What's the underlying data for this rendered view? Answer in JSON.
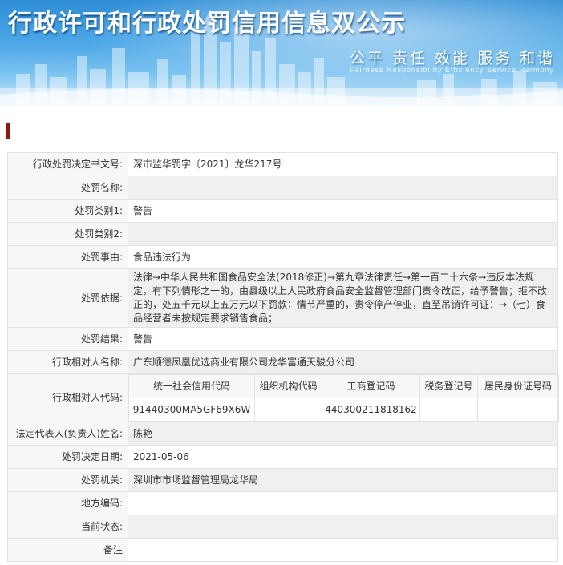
{
  "banner": {
    "title": "行政许可和行政处罚信用信息双公示",
    "slogan": "公平  责任  效能  服务  和谐",
    "slogan_en": "Fairness  Responsibility  Efficiency  Service  Harmony"
  },
  "colors": {
    "banner_top": "#2f8ed6",
    "banner_bottom": "#cfe8f8",
    "section_marker": "#8b1a1a",
    "label_bg": "#f7f7f7",
    "alt_row_bg": "#f0f0f0",
    "border": "#e2e2e2"
  },
  "record": {
    "doc_no": {
      "label": "行政处罚决定书文号:",
      "value": "深市监华罚字〔2021〕龙华217号"
    },
    "penalty_name": {
      "label": "处罚名称:",
      "value": ""
    },
    "category1": {
      "label": "处罚类别1:",
      "value": "警告"
    },
    "category2": {
      "label": "处罚类别2:",
      "value": ""
    },
    "reason": {
      "label": "处罚事由:",
      "value": "食品违法行为"
    },
    "basis": {
      "label": "处罚依据:",
      "value": "法律→中华人民共和国食品安全法(2018修正)→第九章法律责任→第一百二十六条→违反本法规定，有下列情形之一的，由县级以上人民政府食品安全监督管理部门责令改正，给予警告；拒不改正的，处五千元以上五万元以下罚款；情节严重的，责令停产停业，直至吊销许可证：→（七）食品经营者未按规定要求销售食品；"
    },
    "result": {
      "label": "处罚结果:",
      "value": "警告"
    },
    "party_name": {
      "label": "行政相对人名称:",
      "value": "广东顺德凤凰优选商业有限公司龙华富通天骏分公司"
    },
    "party_code": {
      "label": "行政相对人代码:",
      "headers": [
        "统一社会信用代码",
        "组织机构代码",
        "工商登记码",
        "税务登记号",
        "居民身份证号码"
      ],
      "values": [
        "91440300MA5GF69X6W",
        "",
        "440300211818162",
        "",
        ""
      ]
    },
    "legal_rep": {
      "label": "法定代表人(负责人)姓名:",
      "value": "陈艳"
    },
    "decision_date": {
      "label": "处罚决定日期:",
      "value": "2021-05-06"
    },
    "authority": {
      "label": "处罚机关:",
      "value": "深圳市市场监督管理局龙华局"
    },
    "region_code": {
      "label": "地方编码:",
      "value": ""
    },
    "status": {
      "label": "当前状态:",
      "value": ""
    },
    "remarks": {
      "label": "备注",
      "value": ""
    }
  }
}
